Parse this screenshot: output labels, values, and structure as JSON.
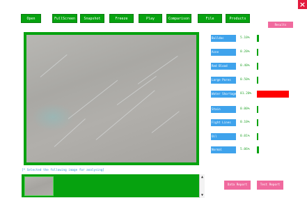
{
  "window": {
    "close_label": "×"
  },
  "toolbar": {
    "buttons": [
      {
        "label": "Open"
      },
      {
        "label": "FullScreen"
      },
      {
        "label": "Snapshot"
      },
      {
        "label": "Freeze"
      },
      {
        "label": "Play"
      },
      {
        "label": "Comparison"
      },
      {
        "label": "File"
      },
      {
        "label": "Products"
      }
    ]
  },
  "results_button": {
    "label": "Results"
  },
  "classifications": [
    {
      "label": "Bulldoc",
      "pct": "5.10%",
      "value": 0.051
    },
    {
      "label": "Acne",
      "pct": "0.20%",
      "value": 0.002
    },
    {
      "label": "Red Blood",
      "pct": "0.40%",
      "value": 0.004
    },
    {
      "label": "Large Pores",
      "pct": "0.50%",
      "value": 0.005
    },
    {
      "label": "Water Shortage",
      "pct": "81.20%",
      "value": 0.812,
      "color": "#ff0000"
    },
    {
      "label": "Stain",
      "pct": "0.00%",
      "value": 0.0
    },
    {
      "label": "Fight Lines",
      "pct": "0.10%",
      "value": 0.001
    },
    {
      "label": "Oil",
      "pct": "0.01%",
      "value": 0.0001
    },
    {
      "label": "Normal",
      "pct": "5.06%",
      "value": 0.0506,
      "color": "#06a20f"
    }
  ],
  "thumbnails": {
    "hint": "[* Selected the following image for analysing]"
  },
  "scrollbar": {
    "up": "▲",
    "down": "▼"
  },
  "actions": {
    "data_report": "Data Report",
    "test_report": "Test Report"
  },
  "colors": {
    "accent_green": "#06a20f",
    "label_blue": "#3fa3ec",
    "pink": "#f06a9e",
    "close_red": "#e31b3d"
  }
}
